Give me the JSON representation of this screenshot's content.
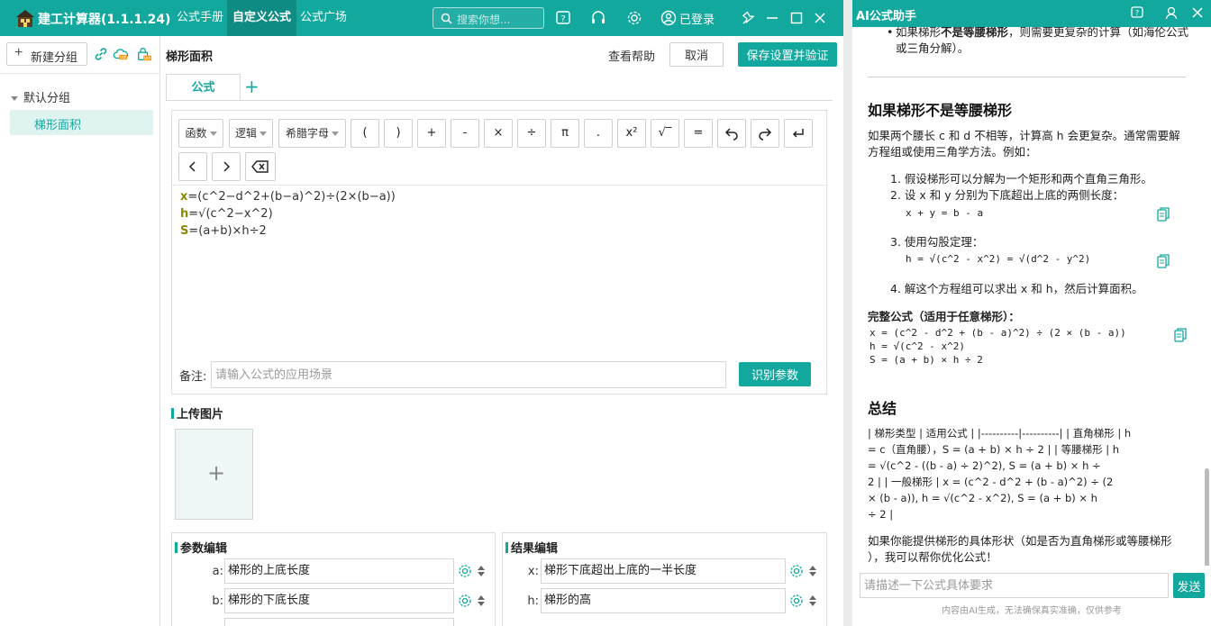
{
  "app": {
    "title": "建工计算器(1.1.1.24)",
    "tabs": [
      "公式手册",
      "自定义公式",
      "公式广场"
    ],
    "active_tab": "自定义公式",
    "search_placeholder": "搜索你想...",
    "login_label": "已登录",
    "accent_color": "#13a89e"
  },
  "sidebar": {
    "new_group_label": "新建分组",
    "group_name": "默认分组",
    "items": [
      "梯形面积"
    ]
  },
  "editor": {
    "formula_name": "梯形面积",
    "help_label": "查看帮助",
    "cancel_label": "取消",
    "save_label": "保存设置并验证",
    "tab_label": "公式",
    "dropdowns": [
      "函数",
      "逻辑",
      "希腊字母"
    ],
    "keys": [
      "(",
      ")",
      "+",
      "-",
      "×",
      "÷",
      "π",
      ".",
      "x²",
      "√‾",
      "="
    ],
    "formulas": [
      {
        "var": "x",
        "expr": "=(c^2−d^2+(b−a)^2)÷(2×(b−a))"
      },
      {
        "var": "h",
        "expr": "=√(c^2−x^2)"
      },
      {
        "var": "S",
        "expr": "=(a+b)×h÷2"
      }
    ],
    "note_label": "备注:",
    "note_placeholder": "请输入公式的应用场景",
    "identify_label": "识别参数"
  },
  "upload": {
    "title": "上传图片",
    "plus": "+"
  },
  "params": {
    "title": "参数编辑",
    "rows": [
      {
        "name": "a:",
        "desc": "梯形的上底长度"
      },
      {
        "name": "b:",
        "desc": "梯形的下底长度"
      }
    ]
  },
  "results": {
    "title": "结果编辑",
    "rows": [
      {
        "name": "x:",
        "desc": "梯形下底超出上底的一半长度"
      },
      {
        "name": "h:",
        "desc": "梯形的高"
      }
    ]
  },
  "ai": {
    "title": "AI公式助手",
    "bullet_pre": "如果梯形",
    "bullet_bold": "不是等腰梯形",
    "bullet_post": "，则需要更复杂的计算（如海伦公式或三角分解）。",
    "heading1": "如果梯形不是等腰梯形",
    "para1": "如果两个腰长 c 和 d 不相等，计算高 h 会更复杂。通常需要解方程组或使用三角学方法。例如：",
    "steps": [
      "1. 假设梯形可以分解为一个矩形和两个直角三角形。",
      "2. 设 x 和 y 分别为下底超出上底的两侧长度：",
      "3. 使用勾股定理：",
      "4. 解这个方程组可以求出 x 和 h，然后计算面积。"
    ],
    "code1": "x + y = b - a",
    "code2": "h = √(c^2 - x^2) = √(d^2 - y^2)",
    "full_title": "完整公式（适用于任意梯形）：",
    "full_code": "x = (c^2 - d^2 + (b - a)^2) ÷ (2 × (b - a))\nh = √(c^2 - x^2)\nS = (a + b) × h ÷ 2",
    "heading2": "总结",
    "summary_lines": [
      "| 梯形类型 | 适用公式 | |----------|----------| | 直角梯形 | h",
      "= c（直角腰），S = (a + b) × h ÷ 2 | | 等腰梯形 | h",
      "= √(c^2 - ((b - a) ÷ 2)^2), S = (a + b) × h ÷",
      "2 | | 一般梯形 | x = (c^2 - d^2 + (b - a)^2) ÷ (2",
      "× (b - a)), h = √(c^2 - x^2), S = (a + b) × h",
      "÷ 2 |"
    ],
    "closing1": "如果你能提供梯形的具体形状（如是否为直角梯形或等腰梯形",
    "closing2": "），我可以帮你优化公式！",
    "input_placeholder": "请描述一下公式具体要求",
    "send_label": "发送",
    "footer": "内容由AI生成，无法确保真实准确，仅供参考"
  }
}
